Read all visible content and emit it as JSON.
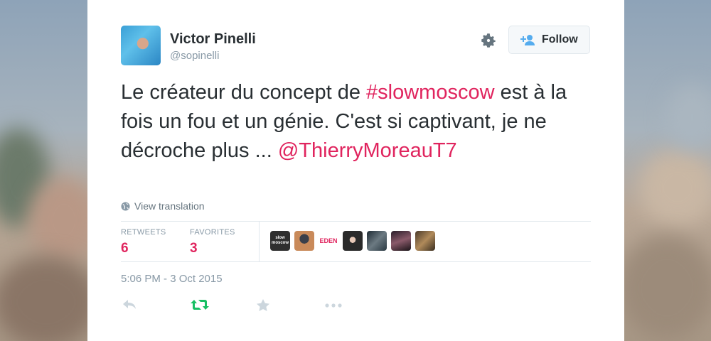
{
  "user": {
    "name": "Victor Pinelli",
    "handle": "@sopinelli"
  },
  "follow_button": {
    "label": "Follow"
  },
  "tweet": {
    "text_part1": "Le créateur du concept de ",
    "hashtag": "#slowmoscow",
    "text_part2": " est à la fois un fou et un génie. C'est si captivant, je ne décroche plus ... ",
    "mention": "@ThierryMoreauT7"
  },
  "view_translation": "View translation",
  "stats": {
    "retweets_label": "RETWEETS",
    "retweets_value": "6",
    "favorites_label": "FAVORITES",
    "favorites_value": "3"
  },
  "faces": {
    "eden_label": "EDEN",
    "slow_label": "slow moscow"
  },
  "timestamp": "5:06 PM - 3 Oct 2015",
  "colors": {
    "accent": "#e0245e",
    "retweet_green": "#17bf63",
    "muted": "#8899a6",
    "text": "#292f33"
  },
  "icons": [
    "gear-icon",
    "follow-user-icon",
    "globe-icon",
    "reply-icon",
    "retweet-icon",
    "favorite-icon",
    "more-icon"
  ]
}
